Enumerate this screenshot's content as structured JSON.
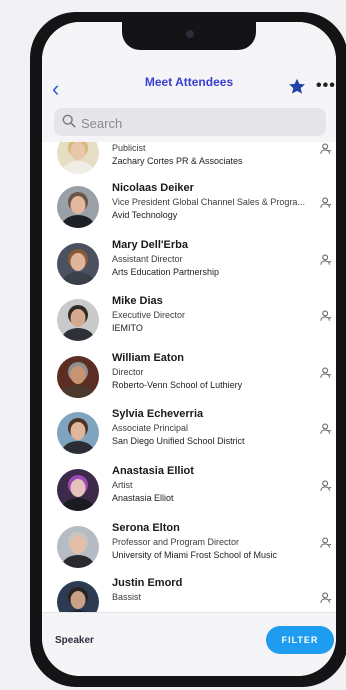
{
  "header": {
    "title": "Meet Attendees"
  },
  "search": {
    "placeholder": "Search"
  },
  "attendees": [
    {
      "name": "",
      "role": "Publicist",
      "org": "Zachary Cortes PR & Associates",
      "avatar_bg": "#e6ddc5",
      "skin": "#e9c7ad",
      "hair": "#d8b877",
      "shirt": "#f0ede6"
    },
    {
      "name": "Nicolaas Deiker",
      "role": "Vice President Global Channel Sales & Progra...",
      "org": "Avid Technology",
      "avatar_bg": "#9aa0a8",
      "skin": "#e4b79f",
      "hair": "#6a5648",
      "shirt": "#1e2026"
    },
    {
      "name": "Mary Dell'Erba",
      "role": "Assistant Director",
      "org": "Arts Education Partnership",
      "avatar_bg": "#4b5160",
      "skin": "#e1b59c",
      "hair": "#8a5a36",
      "shirt": "#3a3f4a"
    },
    {
      "name": "Mike Dias",
      "role": "Executive Director",
      "org": "IEMITO",
      "avatar_bg": "#c9c9c9",
      "skin": "#d6a98c",
      "hair": "#2d2a28",
      "shirt": "#2e3238"
    },
    {
      "name": "William Eaton",
      "role": "Director",
      "org": "Roberto-Venn School of Luthiery",
      "avatar_bg": "#5c2d22",
      "skin": "#c89472",
      "hair": "#8f8f8f",
      "shirt": "#4a3a2e"
    },
    {
      "name": "Sylvia Echeverria",
      "role": "Associate Principal",
      "org": "San Diego Unified School District",
      "avatar_bg": "#7fa4bf",
      "skin": "#e0b69a",
      "hair": "#4a3222",
      "shirt": "#2a2d33"
    },
    {
      "name": "Anastasia Elliot",
      "role": "Artist",
      "org": "Anastasia Elliot",
      "avatar_bg": "#3d2a4a",
      "skin": "#e6c2b8",
      "hair": "#9c4bb6",
      "shirt": "#1b1b22"
    },
    {
      "name": "Serona Elton",
      "role": "Professor and Program Director",
      "org": "University of Miami Frost School of Music",
      "avatar_bg": "#b7bcc4",
      "skin": "#e4bfa6",
      "hair": "#c9c4c0",
      "shirt": "#2a2a30"
    },
    {
      "name": "Justin Emord",
      "role": "Bassist",
      "org": "",
      "avatar_bg": "#2c3b52",
      "skin": "#c7a286",
      "hair": "#2a2420",
      "shirt": "#1c2533"
    }
  ],
  "footer": {
    "speaker_label": "Speaker",
    "filter_label": "FILTER"
  },
  "colors": {
    "accent": "#1e9cf0",
    "title": "#3a3fd1",
    "back": "#2f5bd3",
    "star": "#2244aa"
  }
}
